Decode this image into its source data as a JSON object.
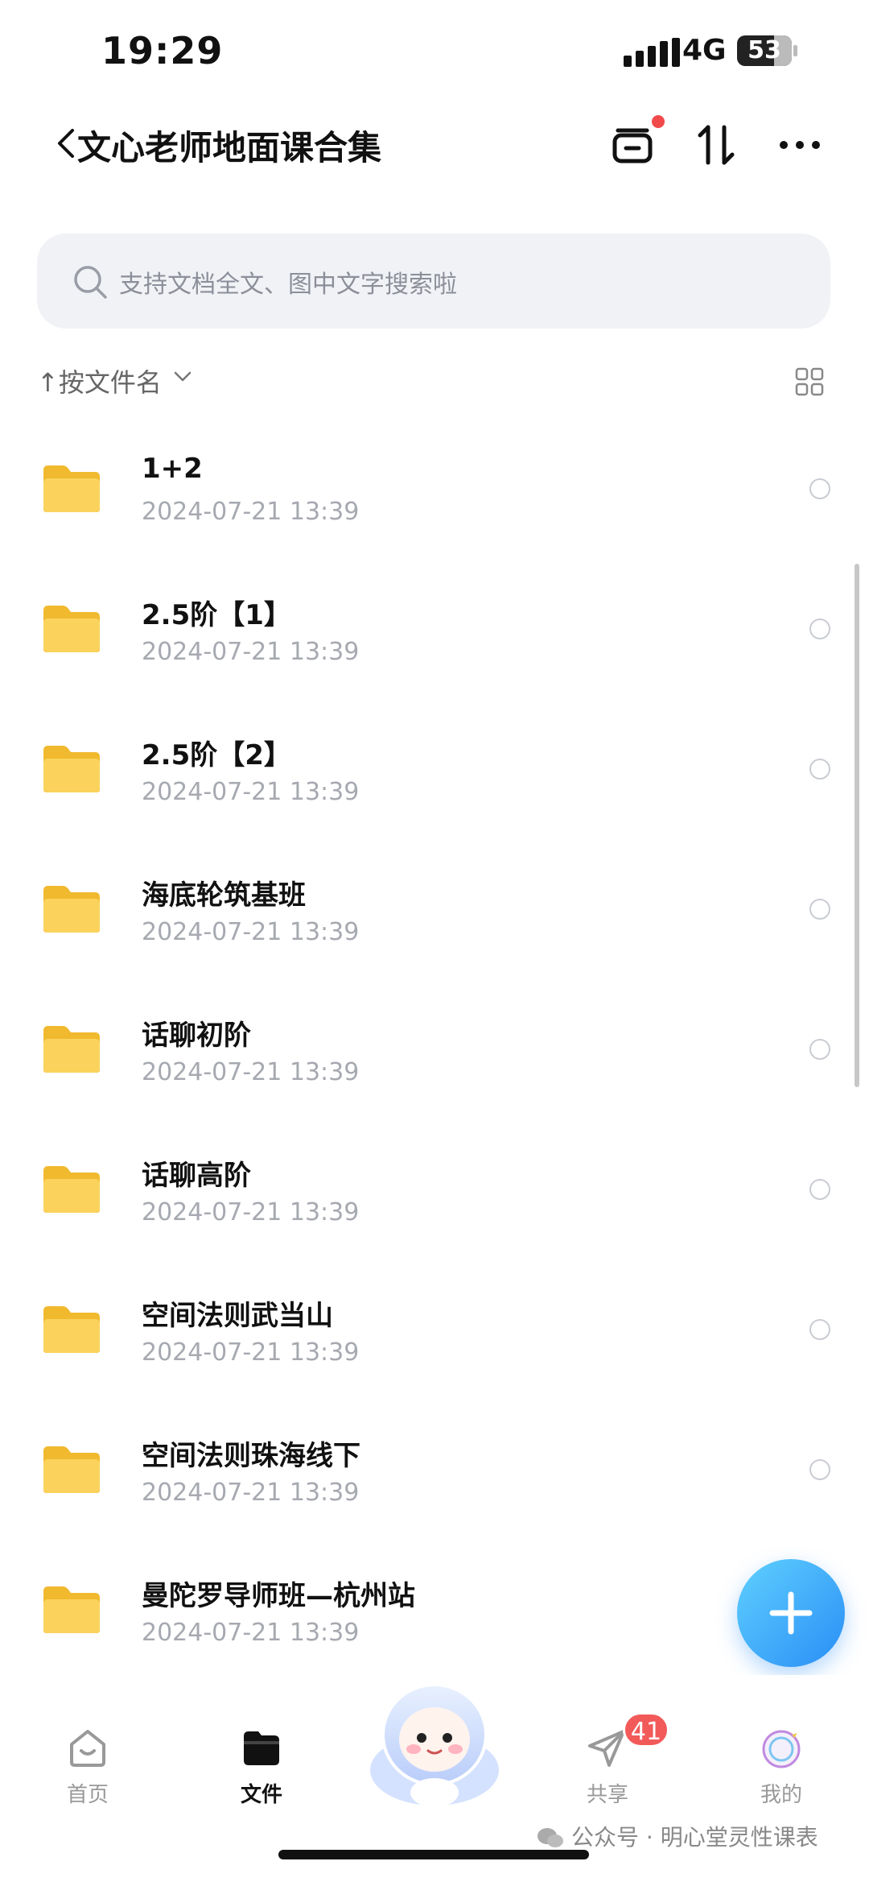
{
  "status_bar": {
    "time": "19:29",
    "network": "4G",
    "battery": "53"
  },
  "header": {
    "title": "文心老师地面课合集"
  },
  "search": {
    "placeholder": "支持文档全文、图中文字搜索啦"
  },
  "sort": {
    "label": "↑按文件名"
  },
  "files": [
    {
      "name": "1+2",
      "date": "2024-07-21 13:39"
    },
    {
      "name": "2.5阶【1】",
      "date": "2024-07-21 13:39"
    },
    {
      "name": "2.5阶【2】",
      "date": "2024-07-21 13:39"
    },
    {
      "name": "海底轮筑基班",
      "date": "2024-07-21 13:39"
    },
    {
      "name": "话聊初阶",
      "date": "2024-07-21 13:39"
    },
    {
      "name": "话聊高阶",
      "date": "2024-07-21 13:39"
    },
    {
      "name": "空间法则武当山",
      "date": "2024-07-21 13:39"
    },
    {
      "name": "空间法则珠海线下",
      "date": "2024-07-21 13:39"
    },
    {
      "name": "曼陀罗导师班—杭州站",
      "date": "2024-07-21 13:39"
    }
  ],
  "tabbar": {
    "home": "首页",
    "files": "文件",
    "share": "共享",
    "share_badge": "41",
    "mine": "我的"
  },
  "watermark": "公众号 · 明心堂灵性课表",
  "colors": {
    "accent": "#2a8ef5",
    "folder": "#f8c94a",
    "badge": "#f25a5a"
  }
}
